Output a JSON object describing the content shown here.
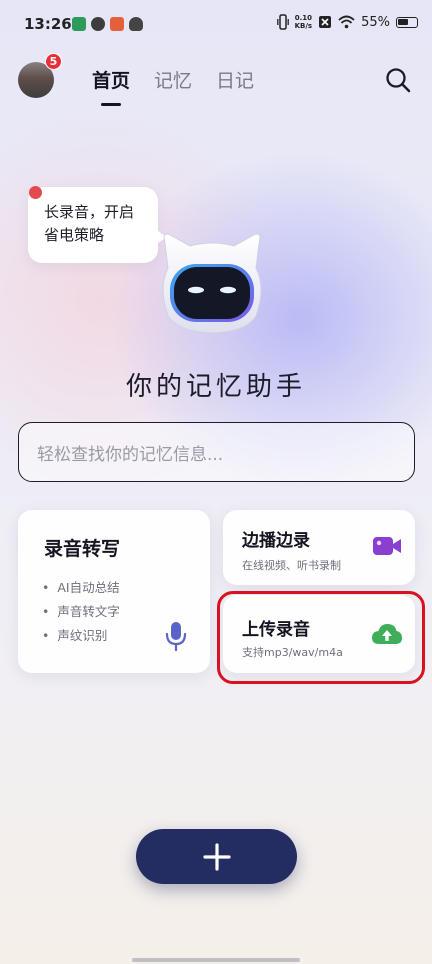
{
  "status_bar": {
    "time": "13:26",
    "net_speed_value": "0.10",
    "net_speed_unit": "KB/s",
    "battery_level": "55%",
    "icons": [
      "signal-icon",
      "vibrate-icon",
      "wifi-icon",
      "battery-icon"
    ]
  },
  "header": {
    "notification_count": "5",
    "tabs": [
      {
        "label": "首页",
        "active": true
      },
      {
        "label": "记忆",
        "active": false
      },
      {
        "label": "日记",
        "active": false
      }
    ]
  },
  "bubble": {
    "text": "长录音，开启\n省电策略"
  },
  "assistant_title": "你的记忆助手",
  "search": {
    "placeholder": "轻松查找你的记忆信息..."
  },
  "cards": {
    "transcribe": {
      "title": "录音转写",
      "features": [
        "AI自动总结",
        "声音转文字",
        "声纹识别"
      ]
    },
    "live_record": {
      "title": "边播边录",
      "subtitle": "在线视频、听书录制"
    },
    "upload": {
      "title": "上传录音",
      "subtitle": "支持mp3/wav/m4a"
    }
  },
  "colors": {
    "primary_dark": "#232d62",
    "badge_red": "#e8303a",
    "mic_blue": "#5a63c8",
    "video_purple": "#8a3fd1",
    "cloud_green": "#3fae5a",
    "highlight_red": "#d8121f"
  }
}
